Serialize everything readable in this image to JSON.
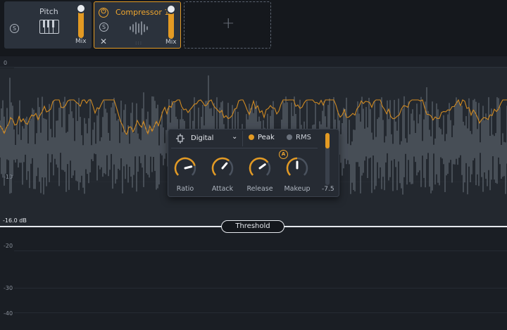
{
  "modules": {
    "pitch": {
      "title": "Pitch",
      "solo_label": "S",
      "mix_label": "Mix",
      "mix_level": 1.0
    },
    "compressor": {
      "title": "Compressor 1",
      "solo_label": "S",
      "mix_label": "Mix",
      "mix_level": 1.0,
      "power_icon": "power-icon",
      "remove_icon": "close-icon"
    },
    "empty_slot": {
      "icon": "plus-icon",
      "symbol": "+"
    }
  },
  "graph": {
    "db_labels": [
      "0",
      "-10",
      "-20",
      "-30",
      "-40"
    ],
    "threshold_value": "-16.0 dB",
    "threshold_label": "Threshold"
  },
  "panel": {
    "mode_select": {
      "value": "Digital",
      "icon": "digital-mode-icon"
    },
    "detection": {
      "peak": "Peak",
      "rms": "RMS",
      "selected": "Peak"
    },
    "auto_badge": "A",
    "knobs": [
      {
        "label": "Ratio",
        "value": 0.78
      },
      {
        "label": "Attack",
        "value": 0.65
      },
      {
        "label": "Release",
        "value": 0.7
      },
      {
        "label": "Makeup",
        "value": 0.5
      }
    ],
    "gain_reduction_value": "-7.5"
  },
  "colors": {
    "accent": "#e39a23",
    "background": "#1a1e24",
    "panel": "#262b33",
    "text": "#c9ced6",
    "threshold": "#e6e9ee",
    "waveform_input": "#6b737e",
    "waveform_output": "#d08a22"
  }
}
